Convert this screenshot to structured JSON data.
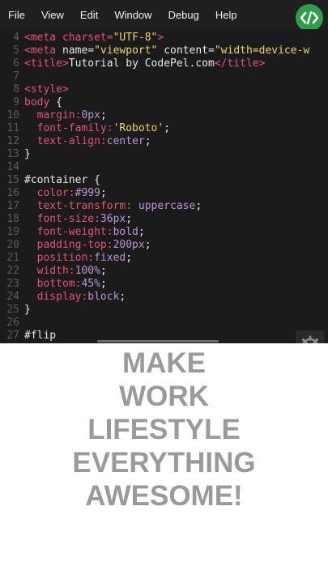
{
  "menu": {
    "items": [
      "File",
      "View",
      "Edit",
      "Window",
      "Debug",
      "Help"
    ]
  },
  "logo": {
    "glyph": "</>",
    "color": "#2e9e4a"
  },
  "editor": {
    "lines": [
      {
        "n": "4",
        "segs": [
          [
            "tag",
            "<meta "
          ],
          [
            "attr",
            "charset="
          ],
          [
            "str",
            "\"UTF-8\""
          ],
          [
            "tag",
            ">"
          ]
        ]
      },
      {
        "n": "5",
        "segs": [
          [
            "tag",
            "<meta "
          ],
          [
            "plain",
            "name="
          ],
          [
            "str",
            "\"viewport\""
          ],
          [
            "plain",
            " content="
          ],
          [
            "str",
            "\"width=device-w"
          ]
        ]
      },
      {
        "n": "6",
        "segs": [
          [
            "tag",
            "<title>"
          ],
          [
            "plain",
            "Tutorial by CodePel.com"
          ],
          [
            "tag",
            "</title>"
          ]
        ]
      },
      {
        "n": "7",
        "segs": []
      },
      {
        "n": "8",
        "segs": [
          [
            "tag",
            "<style>"
          ]
        ]
      },
      {
        "n": "9",
        "segs": [
          [
            "sel",
            "body"
          ],
          [
            "plain",
            " {"
          ]
        ]
      },
      {
        "n": "10",
        "segs": [
          [
            "prop",
            "  margin:"
          ],
          [
            "val",
            "0px"
          ],
          [
            "plain",
            ";"
          ]
        ]
      },
      {
        "n": "11",
        "segs": [
          [
            "prop",
            "  font-family:"
          ],
          [
            "str",
            "'Roboto'"
          ],
          [
            "plain",
            ";"
          ]
        ]
      },
      {
        "n": "12",
        "segs": [
          [
            "prop",
            "  text-align:"
          ],
          [
            "val",
            "center"
          ],
          [
            "plain",
            ";"
          ]
        ]
      },
      {
        "n": "13",
        "segs": [
          [
            "plain",
            "}"
          ]
        ]
      },
      {
        "n": "14",
        "segs": []
      },
      {
        "n": "15",
        "segs": [
          [
            "plain",
            "#container {"
          ]
        ]
      },
      {
        "n": "16",
        "segs": [
          [
            "prop",
            "  color:"
          ],
          [
            "val",
            "#999"
          ],
          [
            "plain",
            ";"
          ]
        ]
      },
      {
        "n": "17",
        "segs": [
          [
            "prop",
            "  text-transform: "
          ],
          [
            "val",
            "uppercase"
          ],
          [
            "plain",
            ";"
          ]
        ]
      },
      {
        "n": "18",
        "segs": [
          [
            "prop",
            "  font-size:"
          ],
          [
            "val",
            "36px"
          ],
          [
            "plain",
            ";"
          ]
        ]
      },
      {
        "n": "19",
        "segs": [
          [
            "prop",
            "  font-weight:"
          ],
          [
            "val",
            "bold"
          ],
          [
            "plain",
            ";"
          ]
        ]
      },
      {
        "n": "20",
        "segs": [
          [
            "prop",
            "  padding-top:"
          ],
          [
            "val",
            "200px"
          ],
          [
            "plain",
            ";"
          ]
        ]
      },
      {
        "n": "21",
        "segs": [
          [
            "prop",
            "  position:"
          ],
          [
            "val",
            "fixed"
          ],
          [
            "plain",
            ";"
          ]
        ]
      },
      {
        "n": "22",
        "segs": [
          [
            "prop",
            "  width:"
          ],
          [
            "val",
            "100%"
          ],
          [
            "plain",
            ";"
          ]
        ]
      },
      {
        "n": "23",
        "segs": [
          [
            "prop",
            "  bottom:"
          ],
          [
            "val",
            "45%"
          ],
          [
            "plain",
            ";"
          ]
        ]
      },
      {
        "n": "24",
        "segs": [
          [
            "prop",
            "  display:"
          ],
          [
            "val",
            "block"
          ],
          [
            "plain",
            ";"
          ]
        ]
      },
      {
        "n": "25",
        "segs": [
          [
            "plain",
            "}"
          ]
        ]
      },
      {
        "n": "26",
        "segs": []
      },
      {
        "n": "27",
        "segs": [
          [
            "plain",
            "#flip"
          ]
        ]
      }
    ]
  },
  "preview": {
    "words": [
      "Make",
      "Work",
      "Lifestyle",
      "Everything",
      "Awesome!"
    ],
    "color": "#999"
  },
  "settings": {
    "icon": "settings-tools-icon"
  }
}
